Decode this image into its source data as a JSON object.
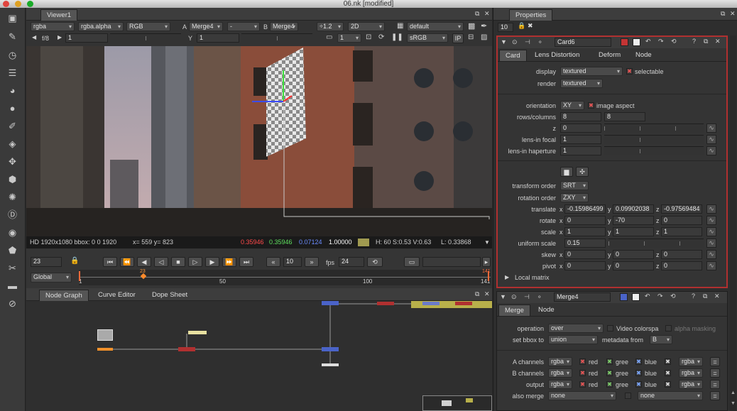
{
  "window": {
    "title": "06.nk [modified]"
  },
  "viewer": {
    "tab_label": "Viewer1",
    "channels": "rgba",
    "alpha_channel": "rgba.alpha",
    "colorspace_display": "RGB",
    "input_a_label": "A",
    "input_a": "Merge4",
    "input_a2": "-",
    "input_b_label": "B",
    "input_b": "Merge4",
    "zoom": "÷1.2",
    "view_mode": "2D",
    "lut": "default",
    "fstop": "f/8",
    "gain_value": "1",
    "y_label": "Y",
    "gamma_value": "1",
    "proxy_value": "1",
    "display_lut": "sRGB",
    "ip_label": "IP",
    "status_format": "HD 1920x1080 bbox: 0 0 1920",
    "status_xy": "x= 559 y= 823",
    "status_r": "0.35946",
    "status_g": "0.35946",
    "status_b": "0.07124",
    "status_a": "1.00000",
    "status_hsv": "H: 60 S:0.53 V:0.63",
    "status_l": "L: 0.33868",
    "frame_current": "23",
    "frame_step": "10",
    "fps_label": "fps",
    "fps_value": "24",
    "range_mode": "Global",
    "timeline_start": "1",
    "timeline_50": "50",
    "timeline_100": "100",
    "timeline_end": "141",
    "timeline_marker": "23"
  },
  "node_panel": {
    "tabs": [
      "Node Graph",
      "Curve Editor",
      "Dope Sheet"
    ]
  },
  "properties": {
    "title": "Properties",
    "max_panels": "10",
    "card": {
      "name": "Card6",
      "tabs": [
        "Card",
        "Lens Distortion",
        "Deform",
        "Node"
      ],
      "display_label": "display",
      "display_value": "textured",
      "selectable_label": "selectable",
      "render_label": "render",
      "render_value": "textured",
      "orientation_label": "orientation",
      "orientation_value": "XY",
      "image_aspect_label": "image aspect",
      "rows_label": "rows/columns",
      "rows_value": "8",
      "cols_value": "8",
      "z_label": "z",
      "z_value": "0",
      "lens_focal_label": "lens-in focal",
      "lens_focal_value": "1",
      "lens_hap_label": "lens-in haperture",
      "lens_hap_value": "1",
      "transform_order_label": "transform order",
      "transform_order_value": "SRT",
      "rotation_order_label": "rotation order",
      "rotation_order_value": "ZXY",
      "translate_label": "translate",
      "translate_x": "-0.15986499",
      "translate_y": "0.09902038",
      "translate_z": "-0.97569484",
      "rotate_label": "rotate",
      "rotate_x": "0",
      "rotate_y": "-70",
      "rotate_z": "0",
      "scale_label": "scale",
      "scale_x": "1",
      "scale_y": "1",
      "scale_z": "1",
      "uniform_scale_label": "uniform scale",
      "uniform_scale_value": "0.15",
      "skew_label": "skew",
      "skew_x": "0",
      "skew_y": "0",
      "skew_z": "0",
      "pivot_label": "pivot",
      "pivot_x": "0",
      "pivot_y": "0",
      "pivot_z": "0",
      "local_matrix_label": "Local matrix",
      "x_label": "x",
      "y_label": "y",
      "z_axis_label": "z"
    },
    "merge": {
      "name": "Merge4",
      "tabs": [
        "Merge",
        "Node"
      ],
      "operation_label": "operation",
      "operation_value": "over",
      "video_colorspace_label": "Video colorspa",
      "alpha_masking_label": "alpha masking",
      "bbox_label": "set bbox to",
      "bbox_value": "union",
      "metadata_label": "metadata from",
      "metadata_value": "B",
      "a_channels_label": "A channels",
      "b_channels_label": "B channels",
      "output_label": "output",
      "also_merge_label": "also merge",
      "channel_value": "rgba",
      "red_label": "red",
      "green_label": "gree",
      "blue_label": "blue",
      "also_merge_value": "none",
      "also_merge_value2": "none"
    }
  },
  "colors": {
    "red_readout": "#ff4a4a",
    "green_readout": "#5fe05f",
    "blue_readout": "#6b8cff",
    "selected_panel_border": "#b03030"
  }
}
